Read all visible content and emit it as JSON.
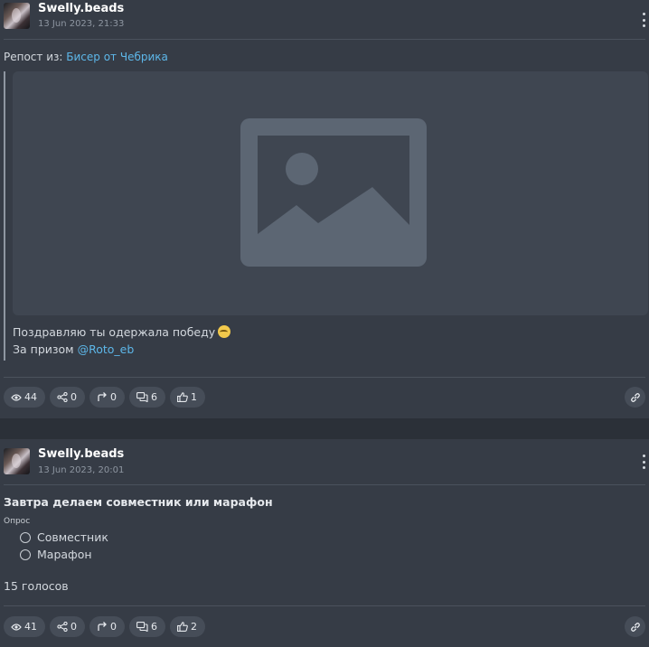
{
  "colors": {
    "page_bg": "#2b3038",
    "card_bg": "#363c46",
    "link": "#5db7e9",
    "pill_bg": "#464d58",
    "placeholder_bg": "#3f4651",
    "placeholder_icon": "#5c6673"
  },
  "posts": [
    {
      "author": "Swelly.beads",
      "date": "13 Jun 2023, 21:33",
      "repost_prefix": "Репост из: ",
      "repost_source": "Бисер от Чебрика",
      "image_icon": "image-placeholder-icon",
      "text_line1": "Поздравляю ты одержала победу",
      "text_line1_emoji": "sleepy-face-emoji",
      "text_line2_prefix": "За призом ",
      "mention": "@Roto_eb",
      "stats": {
        "views": "44",
        "shares": "0",
        "reposts": "0",
        "comments": "6",
        "likes": "1"
      }
    },
    {
      "author": "Swelly.beads",
      "date": "13 Jun 2023, 20:01",
      "poll_title": "Завтра делаем совместник или марафон",
      "poll_label": "Опрос",
      "poll_options": [
        "Совместник",
        "Марафон"
      ],
      "votes": "15 голосов",
      "stats": {
        "views": "41",
        "shares": "0",
        "reposts": "0",
        "comments": "6",
        "likes": "2"
      }
    }
  ]
}
